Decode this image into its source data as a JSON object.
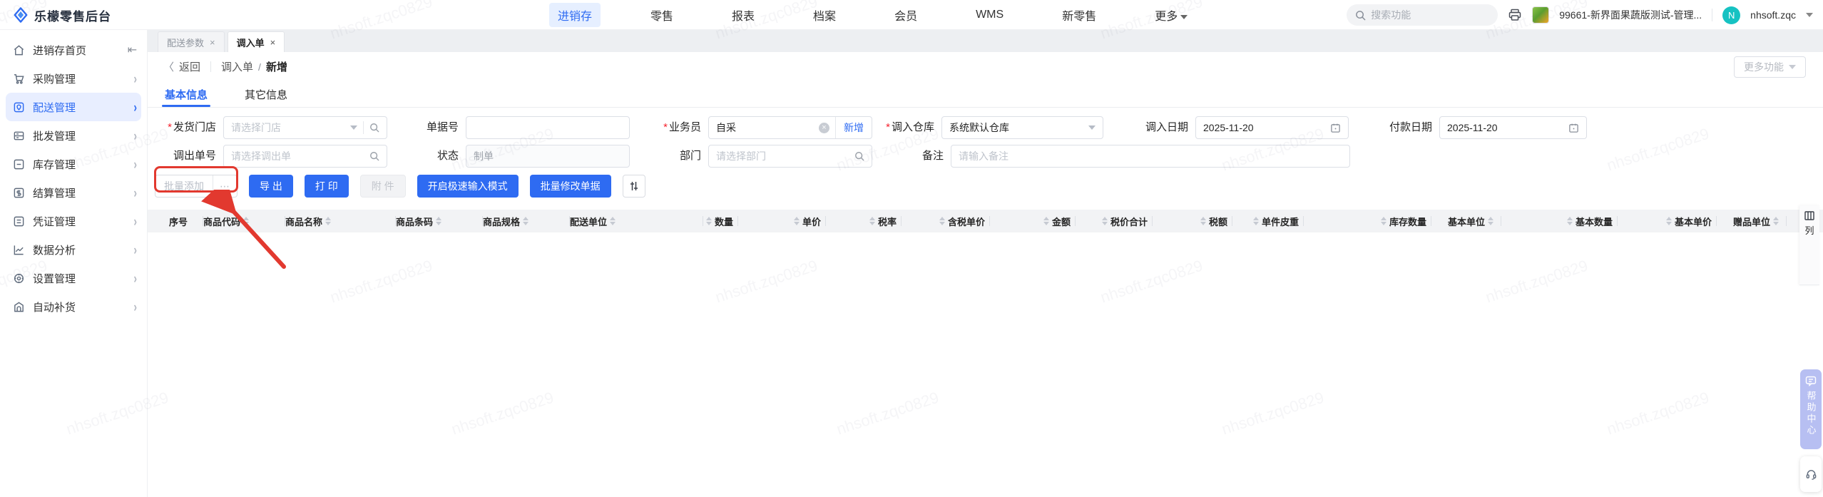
{
  "app": {
    "logo_text": "乐檬零售后台",
    "nav": [
      {
        "label": "进销存"
      },
      {
        "label": "零售"
      },
      {
        "label": "报表"
      },
      {
        "label": "档案"
      },
      {
        "label": "会员"
      },
      {
        "label": "WMS"
      },
      {
        "label": "新零售"
      },
      {
        "label": "更多"
      }
    ],
    "search_placeholder": "搜索功能",
    "store_name": "99661-新界面果蔬版测试-管理...",
    "user": {
      "initial": "N",
      "name": "nhsoft.zqc"
    }
  },
  "sidebar": {
    "items": [
      {
        "label": "进销存首页"
      },
      {
        "label": "采购管理"
      },
      {
        "label": "配送管理"
      },
      {
        "label": "批发管理"
      },
      {
        "label": "库存管理"
      },
      {
        "label": "结算管理"
      },
      {
        "label": "凭证管理"
      },
      {
        "label": "数据分析"
      },
      {
        "label": "设置管理"
      },
      {
        "label": "自动补货"
      }
    ]
  },
  "worktabs": [
    {
      "label": "配送参数"
    },
    {
      "label": "调入单"
    }
  ],
  "page": {
    "back": "返回",
    "breadcrumb_parent": "调入单",
    "breadcrumb_current": "新增",
    "more_button": "更多功能"
  },
  "form_tabs": [
    {
      "label": "基本信息"
    },
    {
      "label": "其它信息"
    }
  ],
  "form": {
    "store": {
      "label": "发货门店",
      "placeholder": "请选择门店"
    },
    "doc_no": {
      "label": "单据号",
      "value": ""
    },
    "salesman": {
      "label": "业务员",
      "value": "自采",
      "add_link": "新增"
    },
    "warehouse": {
      "label": "调入仓库",
      "value": "系统默认仓库"
    },
    "in_date": {
      "label": "调入日期",
      "value": "2025-11-20"
    },
    "pay_date": {
      "label": "付款日期",
      "value": "2025-11-20"
    },
    "out_no": {
      "label": "调出单号",
      "placeholder": "请选择调出单"
    },
    "status": {
      "label": "状态",
      "value": "制单"
    },
    "dept": {
      "label": "部门",
      "placeholder": "请选择部门"
    },
    "remark": {
      "label": "备注",
      "placeholder": "请输入备注"
    }
  },
  "toolbar": {
    "batch_add": "批量添加",
    "export": "导 出",
    "print": "打 印",
    "attachment": "附 件",
    "speed_mode": "开启极速输入模式",
    "batch_edit": "批量修改单据"
  },
  "table": {
    "columns": [
      {
        "label": "序号"
      },
      {
        "label": "商品代码"
      },
      {
        "label": "商品名称"
      },
      {
        "label": "商品条码"
      },
      {
        "label": "商品规格"
      },
      {
        "label": "配送单位"
      },
      {
        "label": "数量"
      },
      {
        "label": "单价"
      },
      {
        "label": "税率"
      },
      {
        "label": "含税单价"
      },
      {
        "label": "金额"
      },
      {
        "label": "税价合计"
      },
      {
        "label": "税额"
      },
      {
        "label": "单件皮重"
      },
      {
        "label": "库存数量"
      },
      {
        "label": "基本单位"
      },
      {
        "label": "基本数量"
      },
      {
        "label": "基本单价"
      },
      {
        "label": "赠品单位"
      }
    ],
    "column_tool": "列"
  },
  "floating": {
    "help": "帮助中心"
  },
  "watermark": {
    "text": "nhsoft.zqc0829"
  }
}
